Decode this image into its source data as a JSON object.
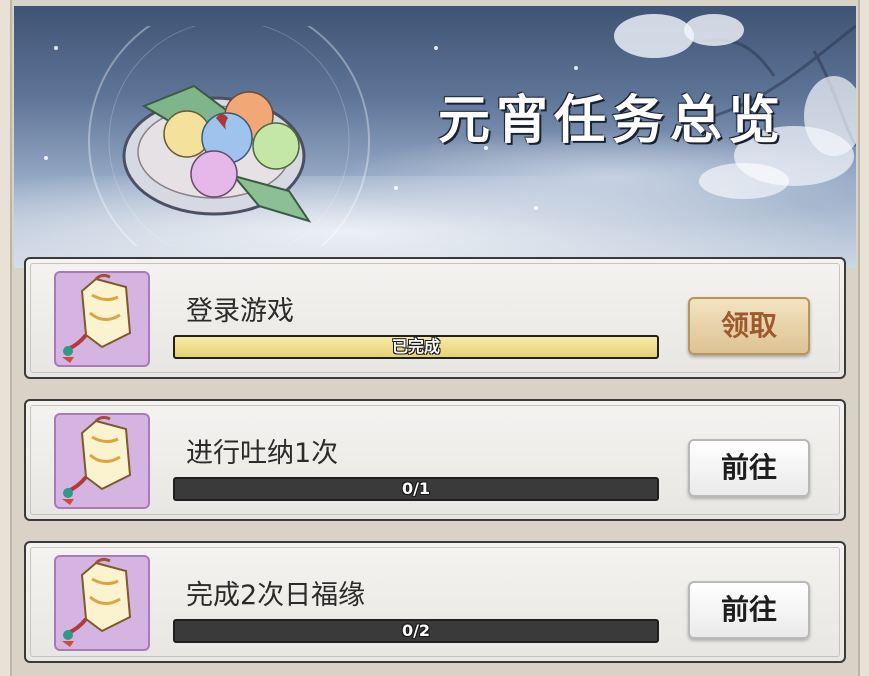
{
  "header": {
    "title": "元宵任务总览"
  },
  "tasks": [
    {
      "name": "登录游戏",
      "progress_text": "已完成",
      "progress": 1.0,
      "status": "completed",
      "button_label": "领取"
    },
    {
      "name": "进行吐纳1次",
      "progress_text": "0/1",
      "progress": 0.0,
      "status": "in-progress",
      "button_label": "前往"
    },
    {
      "name": "完成2次日福缘",
      "progress_text": "0/2",
      "progress": 0.0,
      "status": "in-progress",
      "button_label": "前往"
    }
  ],
  "icons": {
    "banner": "tangyuan-plate-icon",
    "reward": "lantern-reward-icon"
  },
  "colors": {
    "progress_fill": "#e7d272",
    "claim_text": "#a0592d",
    "reward_icon_bg": "#d6b4e2"
  }
}
